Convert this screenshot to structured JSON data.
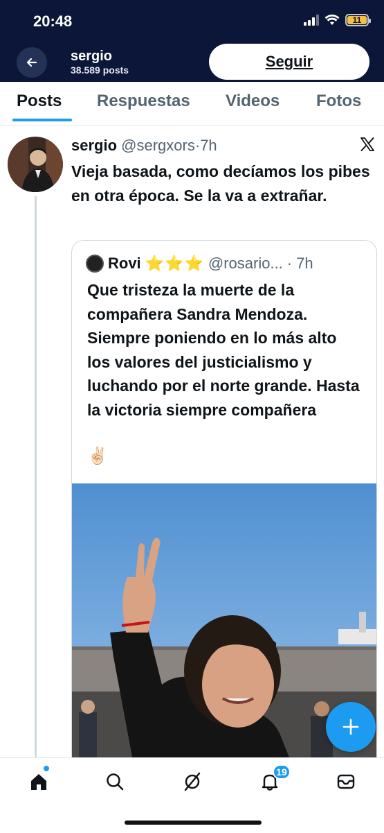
{
  "status_bar": {
    "time": "20:48",
    "battery": "11"
  },
  "header": {
    "profile_name": "sergio",
    "post_count": "38.589 posts",
    "follow_label": "Seguir"
  },
  "tabs": [
    "Posts",
    "Respuestas",
    "Videos",
    "Fotos"
  ],
  "tweet": {
    "name": "sergio",
    "handle": "@sergxors",
    "separator": "·",
    "time": "7h",
    "text": "Vieja basada, como decíamos los pibes en otra época. Se la va a extrañar."
  },
  "quote": {
    "name": "Rovi",
    "stars": "⭐⭐⭐",
    "handle": "@rosario...",
    "separator": "·",
    "time": "7h",
    "text": "Que tristeza la muerte de la compañera Sandra Mendoza. Siempre poniendo en lo más alto los valores del justicialismo y luchando por el norte grande. Hasta la victoria siempre compañera",
    "emoji": "✌🏻"
  },
  "bottom_nav": {
    "items": [
      "home-icon",
      "search-icon",
      "grok-icon",
      "notifications-icon",
      "messages-icon"
    ],
    "notifications_badge": "19"
  },
  "colors": {
    "header_bg": "#0b1638",
    "accent": "#1d9bf0",
    "muted": "#536471"
  }
}
